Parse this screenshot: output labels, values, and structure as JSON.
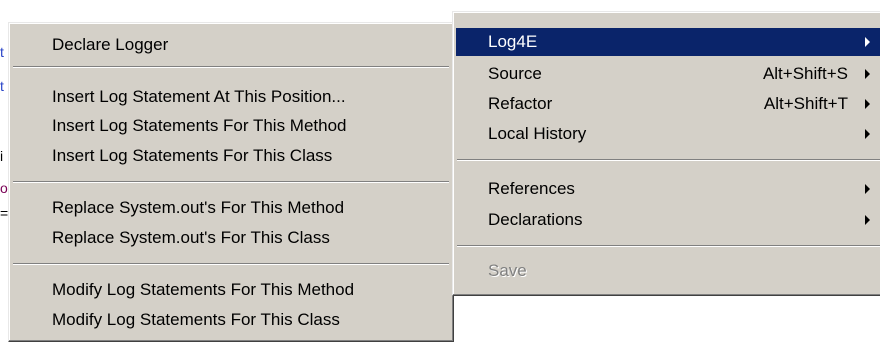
{
  "background": {
    "glyphs": [
      "t",
      "t",
      "i",
      "o",
      "="
    ]
  },
  "log4e_submenu": {
    "items": [
      "Declare Logger",
      "Insert Log Statement At This Position...",
      "Insert Log Statements For This Method",
      "Insert Log Statements For This Class",
      "Replace System.out's For This Method",
      "Replace System.out's For This Class",
      "Modify Log Statements For This Method",
      "Modify Log Statements For This Class"
    ]
  },
  "context_menu": {
    "items": [
      {
        "label": "Log4E",
        "shortcut": "",
        "has_submenu": true,
        "highlighted": true,
        "enabled": true
      },
      {
        "label": "Source",
        "shortcut": "Alt+Shift+S",
        "has_submenu": true,
        "enabled": true
      },
      {
        "label": "Refactor",
        "shortcut": "Alt+Shift+T",
        "has_submenu": true,
        "enabled": true
      },
      {
        "label": "Local History",
        "shortcut": "",
        "has_submenu": true,
        "enabled": true
      },
      {
        "label": "References",
        "shortcut": "",
        "has_submenu": true,
        "enabled": true
      },
      {
        "label": "Declarations",
        "shortcut": "",
        "has_submenu": true,
        "enabled": true
      },
      {
        "label": "Save",
        "shortcut": "",
        "has_submenu": false,
        "enabled": false
      }
    ]
  },
  "colors": {
    "menu_face": "#d4d0c8",
    "highlight": "#0a246a",
    "highlight_text": "#ffffff",
    "disabled_text": "#808080"
  }
}
